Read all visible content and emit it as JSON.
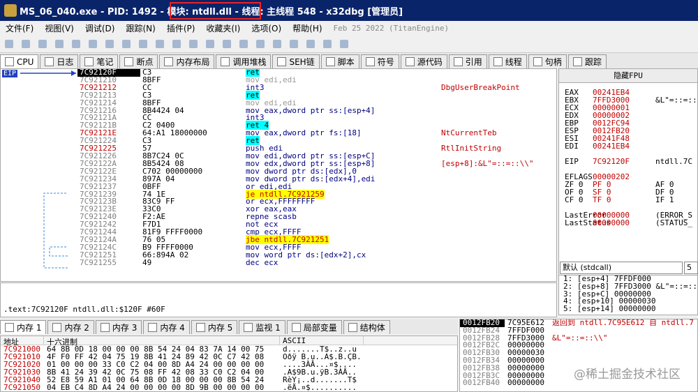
{
  "title": {
    "text": "MS_06_040.exe - PID: 1492 - 模块: ntdll.dll - 线程: 主线程 548 - x32dbg [管理员]"
  },
  "menu": {
    "items": [
      "文件(F)",
      "视图(V)",
      "调试(D)",
      "跟踪(N)",
      "插件(P)",
      "收藏夹(I)",
      "选项(O)",
      "帮助(H)"
    ],
    "date": "Feb 25 2022 (TitanEngine)"
  },
  "tabs": [
    "CPU",
    "日志",
    "笔记",
    "断点",
    "内存布局",
    "调用堆栈",
    "SEH链",
    "脚本",
    "符号",
    "源代码",
    "引用",
    "线程",
    "句柄",
    "跟踪"
  ],
  "eip_label": "EIP",
  "disasm": [
    {
      "addr": "7C92120F",
      "bytes": "C3",
      "dis": "ret",
      "com": ""
    },
    {
      "addr": "7C921210",
      "bytes": "8BFF",
      "dis": "mov edi,edi",
      "com": ""
    },
    {
      "addr": "7C921212",
      "bytes": "CC",
      "dis": "int3",
      "com": "DbgUserBreakPoint"
    },
    {
      "addr": "7C921213",
      "bytes": "C3",
      "dis": "ret",
      "com": ""
    },
    {
      "addr": "7C921214",
      "bytes": "8BFF",
      "dis": "mov edi,edi",
      "com": ""
    },
    {
      "addr": "7C921216",
      "bytes": "8B4424 04",
      "dis": "mov eax,dword ptr ss:[esp+4]",
      "com": ""
    },
    {
      "addr": "7C92121A",
      "bytes": "CC",
      "dis": "int3",
      "com": ""
    },
    {
      "addr": "7C92121B",
      "bytes": "C2 0400",
      "dis": "ret 4",
      "com": ""
    },
    {
      "addr": "7C92121E",
      "bytes": "64:A1 18000000",
      "dis": "mov eax,dword ptr fs:[18]",
      "com": "NtCurrentTeb"
    },
    {
      "addr": "7C921224",
      "bytes": "C3",
      "dis": "ret",
      "com": ""
    },
    {
      "addr": "7C921225",
      "bytes": "57",
      "dis": "push edi",
      "com": "RtlInitString"
    },
    {
      "addr": "7C921226",
      "bytes": "8B7C24 0C",
      "dis": "mov edi,dword ptr ss:[esp+C]",
      "com": ""
    },
    {
      "addr": "7C92122A",
      "bytes": "8B5424 08",
      "dis": "mov edx,dword ptr ss:[esp+8]",
      "com": "[esp+8]:&L\"=::=::\\\\\""
    },
    {
      "addr": "7C92122E",
      "bytes": "C702 00000000",
      "dis": "mov dword ptr ds:[edx],0",
      "com": ""
    },
    {
      "addr": "7C921234",
      "bytes": "897A 04",
      "dis": "mov dword ptr ds:[edx+4],edi",
      "com": ""
    },
    {
      "addr": "7C921237",
      "bytes": "0BFF",
      "dis": "or edi,edi",
      "com": ""
    },
    {
      "addr": "7C921239",
      "bytes": "74 1E",
      "dis": "je ntdll.7C921259",
      "com": ""
    },
    {
      "addr": "7C92123B",
      "bytes": "83C9 FF",
      "dis": "or ecx,FFFFFFFF",
      "com": ""
    },
    {
      "addr": "7C92123E",
      "bytes": "33C0",
      "dis": "xor eax,eax",
      "com": ""
    },
    {
      "addr": "7C921240",
      "bytes": "F2:AE",
      "dis": "repne scasb",
      "com": ""
    },
    {
      "addr": "7C921242",
      "bytes": "F7D1",
      "dis": "not ecx",
      "com": ""
    },
    {
      "addr": "7C921244",
      "bytes": "81F9 FFFF0000",
      "dis": "cmp ecx,FFFF",
      "com": ""
    },
    {
      "addr": "7C92124A",
      "bytes": "76 05",
      "dis": "jbe ntdll.7C921251",
      "com": ""
    },
    {
      "addr": "7C92124C",
      "bytes": "B9 FFFF0000",
      "dis": "mov ecx,FFFF",
      "com": ""
    },
    {
      "addr": "7C921251",
      "bytes": "66:894A 02",
      "dis": "mov word ptr ds:[edx+2],cx",
      "com": ""
    },
    {
      "addr": "7C921255",
      "bytes": "49",
      "dis": "dec ecx",
      "com": ""
    }
  ],
  "regs": {
    "header": "隐藏FPU",
    "rows": [
      {
        "r": "EAX",
        "v": "00241EB4",
        "c": ""
      },
      {
        "r": "EBX",
        "v": "7FFD3000",
        "c": "&L\"=::=::"
      },
      {
        "r": "ECX",
        "v": "00000001",
        "c": ""
      },
      {
        "r": "EDX",
        "v": "00000002",
        "c": ""
      },
      {
        "r": "EBP",
        "v": "0012FC94",
        "c": ""
      },
      {
        "r": "ESP",
        "v": "0012FB20",
        "c": ""
      },
      {
        "r": "ESI",
        "v": "00241F48",
        "c": ""
      },
      {
        "r": "EDI",
        "v": "00241EB4",
        "c": ""
      },
      {
        "r": "",
        "v": "",
        "c": ""
      },
      {
        "r": "EIP",
        "v": "7C92120F",
        "c": "ntdll.7C"
      },
      {
        "r": "",
        "v": "",
        "c": ""
      },
      {
        "r": "EFLAGS",
        "v": "00000202",
        "c": ""
      },
      {
        "r": "ZF 0",
        "v": "PF 0",
        "c": "AF 0"
      },
      {
        "r": "OF 0",
        "v": "SF 0",
        "c": "DF 0"
      },
      {
        "r": "CF 0",
        "v": "TF 0",
        "c": "IF 1"
      },
      {
        "r": "",
        "v": "",
        "c": ""
      },
      {
        "r": "LastError",
        "v": "00000000",
        "c": "(ERROR_S"
      },
      {
        "r": "LastStatus",
        "v": "00000000",
        "c": "(STATUS_"
      }
    ]
  },
  "callconv": {
    "value": "默认 (stdcall)",
    "num": "5"
  },
  "args": [
    "1: [esp+4] 7FFDF000",
    "2: [esp+8] 7FFD3000 &L\"=::=::",
    "3: [esp+C] 00000000",
    "4: [esp+10] 00000030",
    "5: [esp+14] 00000000"
  ],
  "info": {
    "text": ".text:7C92120F ntdll.dll:$120F #60F"
  },
  "btabs": [
    "内存 1",
    "内存 2",
    "内存 3",
    "内存 4",
    "内存 5",
    "监视 1",
    "局部变量",
    "结构体"
  ],
  "dump": {
    "h_addr": "地址",
    "h_hex": "十六进制",
    "h_ascii": "ASCII",
    "rows": [
      {
        "a": "7C921000",
        "x": "64 8B 0D 18 00 00 00 8B 54 24 04 83 7A 14 00 75",
        "c": "d.......T$..z..u"
      },
      {
        "a": "7C921010",
        "x": "4F F0 FF 42 04 75 19 8B 41 24 89 42 0C C7 42 08",
        "c": "Oðÿ B.u..A$.B.ÇB."
      },
      {
        "a": "7C921020",
        "x": "01 00 00 00 33 C0 C2 04 00 8D A4 24 00 00 00 00",
        "c": "....3ÀÂ...¤$...."
      },
      {
        "a": "7C921030",
        "x": "8B 41 24 39 42 0C 75 08 FF 42 08 33 C0 C2 04 00",
        "c": ".A$9B.u.ÿB.3ÀÂ.."
      },
      {
        "a": "7C921040",
        "x": "52 E8 59 A1 01 00 64 8B 0D 18 00 00 00 8B 54 24",
        "c": "RèY¡..d.......T$"
      },
      {
        "a": "7C921050",
        "x": "04 EB C4 8D A4 24 00 00 00 00 8D 9B 00 00 00 00",
        "c": ".ëÄ.¤$.........."
      }
    ]
  },
  "stack": {
    "top": "0012FB20",
    "top_val": "7C95E612",
    "top_com": "返回到 ntdll.7C95E612 自 ntdll.7",
    "rows": [
      {
        "a": "0012FB24",
        "v": "7FFDF000",
        "c": ""
      },
      {
        "a": "0012FB28",
        "v": "7FFD3000",
        "c": "&L\"=::=::\\\\\""
      },
      {
        "a": "0012FB2C",
        "v": "00000000",
        "c": ""
      },
      {
        "a": "0012FB30",
        "v": "00000030",
        "c": ""
      },
      {
        "a": "0012FB34",
        "v": "00000000",
        "c": ""
      },
      {
        "a": "0012FB38",
        "v": "00000000",
        "c": ""
      },
      {
        "a": "0012FB3C",
        "v": "00000000",
        "c": ""
      },
      {
        "a": "0012FB40",
        "v": "00000000",
        "c": ""
      }
    ]
  },
  "watermark": "@稀土掘金技术社区"
}
